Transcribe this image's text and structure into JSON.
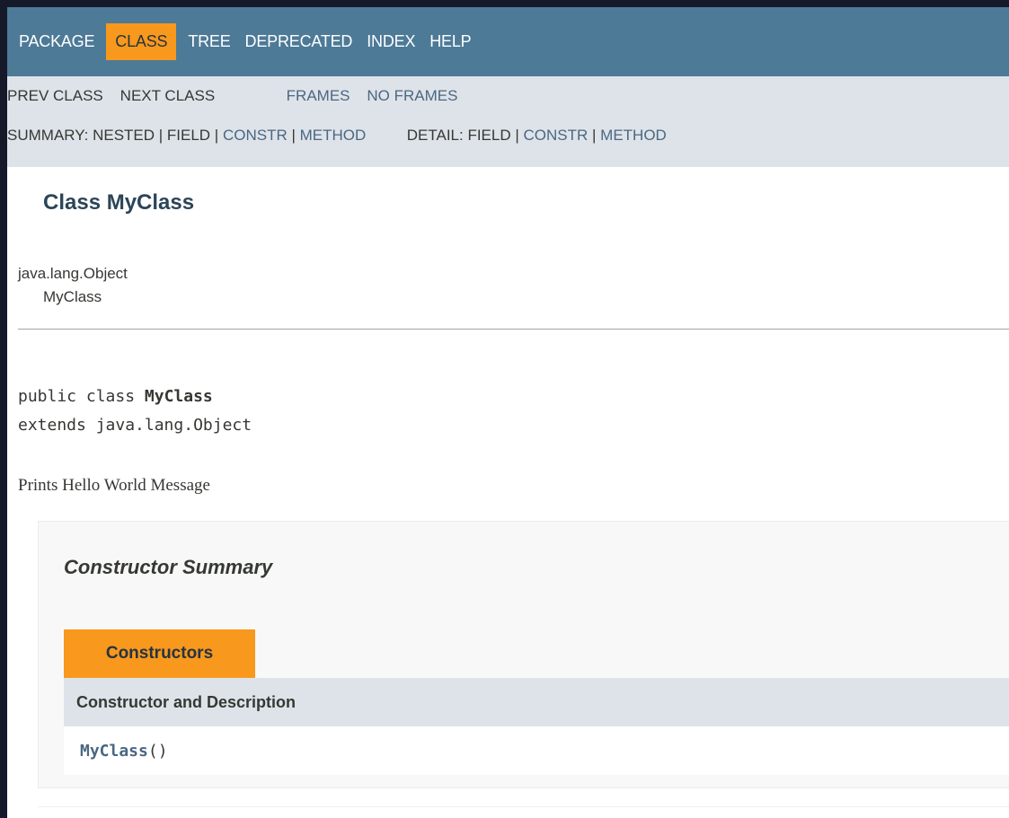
{
  "topnav": {
    "items": [
      "PACKAGE",
      "CLASS",
      "TREE",
      "DEPRECATED",
      "INDEX",
      "HELP"
    ],
    "active": "CLASS"
  },
  "subnav": {
    "prev_class": "PREV CLASS",
    "next_class": "NEXT CLASS",
    "frames": "FRAMES",
    "no_frames": "NO FRAMES",
    "summary_label": "SUMMARY: NESTED | FIELD | ",
    "summary_constr": "CONSTR",
    "sep1": " | ",
    "summary_method": "METHOD",
    "detail_label": "DETAIL: FIELD | ",
    "detail_constr": "CONSTR",
    "sep2": " | ",
    "detail_method": "METHOD"
  },
  "header": {
    "title": "Class MyClass"
  },
  "inheritance": {
    "parent": "java.lang.Object",
    "child": "MyClass"
  },
  "declaration": {
    "modifiers": "public class ",
    "name": "MyClass",
    "extends": "extends java.lang.Object"
  },
  "description": "Prints Hello World Message",
  "constructor_summary": {
    "heading": "Constructor Summary",
    "caption": "Constructors",
    "column_header": "Constructor and Description",
    "rows": [
      {
        "name": "MyClass",
        "params": "()"
      }
    ]
  },
  "colors": {
    "nav_bg": "#4d7a97",
    "accent_orange": "#f8981d",
    "subnav_bg": "#dee3e9",
    "link": "#4a6782",
    "title": "#2c4557"
  }
}
